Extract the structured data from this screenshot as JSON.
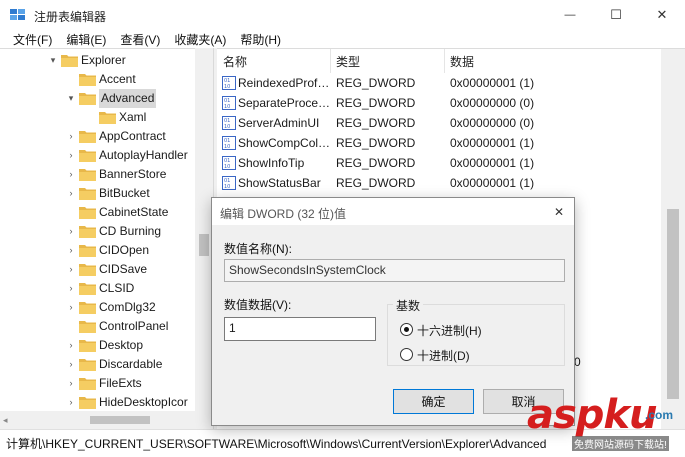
{
  "window": {
    "title": "注册表编辑器",
    "controls": {
      "minimize": "—",
      "maximize": "☐",
      "close": "✕"
    }
  },
  "menu": [
    "文件(F)",
    "编辑(E)",
    "查看(V)",
    "收藏夹(A)",
    "帮助(H)"
  ],
  "tree": {
    "items": [
      {
        "label": "Explorer",
        "arrow": "▾",
        "level": 0,
        "expanded": true
      },
      {
        "label": "Accent",
        "arrow": "",
        "level": 1
      },
      {
        "label": "Advanced",
        "arrow": "▾",
        "level": 1,
        "selected": true
      },
      {
        "label": "Xaml",
        "arrow": "",
        "level": 2
      },
      {
        "label": "AppContract",
        "arrow": "›",
        "level": 1
      },
      {
        "label": "AutoplayHandler",
        "arrow": "›",
        "level": 1
      },
      {
        "label": "BannerStore",
        "arrow": "›",
        "level": 1
      },
      {
        "label": "BitBucket",
        "arrow": "›",
        "level": 1
      },
      {
        "label": "CabinetState",
        "arrow": "",
        "level": 1
      },
      {
        "label": "CD Burning",
        "arrow": "›",
        "level": 1
      },
      {
        "label": "CIDOpen",
        "arrow": "›",
        "level": 1
      },
      {
        "label": "CIDSave",
        "arrow": "›",
        "level": 1
      },
      {
        "label": "CLSID",
        "arrow": "›",
        "level": 1
      },
      {
        "label": "ComDlg32",
        "arrow": "›",
        "level": 1
      },
      {
        "label": "ControlPanel",
        "arrow": "",
        "level": 1
      },
      {
        "label": "Desktop",
        "arrow": "›",
        "level": 1
      },
      {
        "label": "Discardable",
        "arrow": "›",
        "level": 1
      },
      {
        "label": "FileExts",
        "arrow": "›",
        "level": 1
      },
      {
        "label": "HideDesktopIcor",
        "arrow": "›",
        "level": 1
      }
    ]
  },
  "list": {
    "columns": [
      "名称",
      "类型",
      "数据"
    ],
    "rows": [
      {
        "name": "ReindexedProf…",
        "type": "REG_DWORD",
        "data": "0x00000001 (1)"
      },
      {
        "name": "SeparateProce…",
        "type": "REG_DWORD",
        "data": "0x00000000 (0)"
      },
      {
        "name": "ServerAdminUI",
        "type": "REG_DWORD",
        "data": "0x00000000 (0)"
      },
      {
        "name": "ShowCompCol…",
        "type": "REG_DWORD",
        "data": "0x00000001 (1)"
      },
      {
        "name": "ShowInfoTip",
        "type": "REG_DWORD",
        "data": "0x00000001 (1)"
      },
      {
        "name": "ShowStatusBar",
        "type": "REG_DWORD",
        "data": "0x00000001 (1)"
      }
    ],
    "partial_hidden_text": "0"
  },
  "status": {
    "path": "计算机\\HKEY_CURRENT_USER\\SOFTWARE\\Microsoft\\Windows\\CurrentVersion\\Explorer\\Advanced"
  },
  "dialog": {
    "title": "编辑 DWORD (32 位)值",
    "close": "✕",
    "value_name_label": "数值名称(N):",
    "value_name": "ShowSecondsInSystemClock",
    "value_data_label": "数值数据(V):",
    "value_data": "1",
    "base_label": "基数",
    "radio_hex": "十六进制(H)",
    "radio_dec": "十进制(D)",
    "selected_base": "hex",
    "ok_label": "确定",
    "cancel_label": "取消"
  },
  "watermark": {
    "main": "aspku",
    "dotcom": ".com",
    "sub": "免费网站源码下载站!"
  },
  "colors": {
    "folder": "#e8b84a",
    "reg_icon": "#3a66c5",
    "watermark": "#d51e1e",
    "accent": "#0078d7"
  }
}
